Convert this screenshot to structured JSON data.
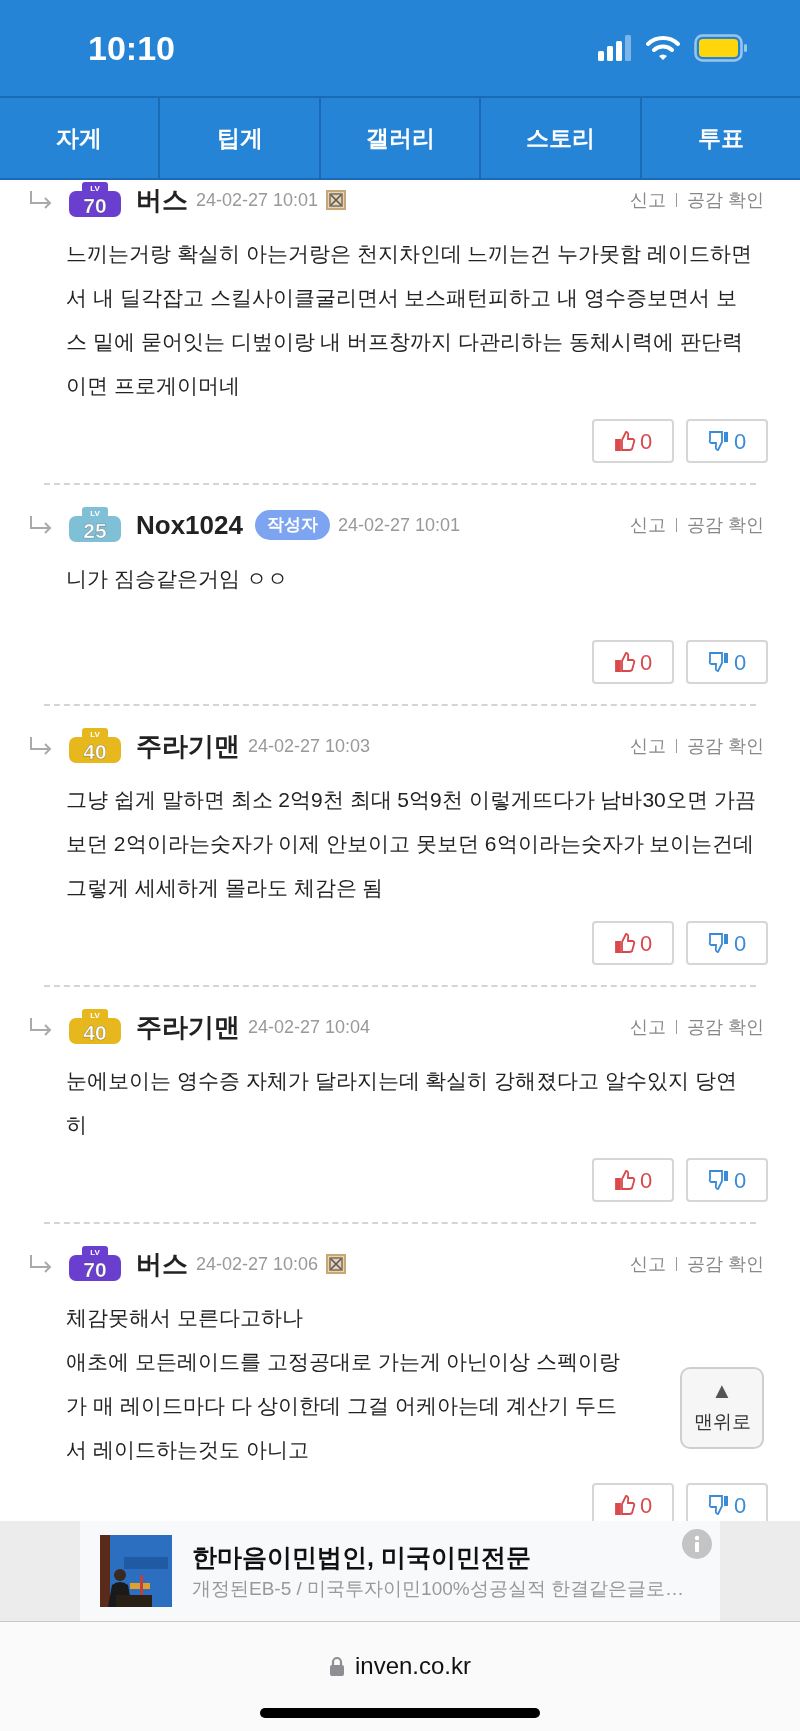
{
  "status_bar": {
    "time": "10:10"
  },
  "tabs": [
    {
      "label": "자게"
    },
    {
      "label": "팁게"
    },
    {
      "label": "갤러리"
    },
    {
      "label": "스토리"
    },
    {
      "label": "투표"
    }
  ],
  "comments": [
    {
      "badge_lv": "LV",
      "badge_level": "70",
      "color": "#6a3fd0",
      "author": "버스",
      "date": "24-02-27 10:01",
      "mark_icon": true,
      "report": "신고",
      "likes_check": "공감 확인",
      "body": "느끼는거랑 확실히 아는거랑은 천지차인데 느끼는건 누가못함 레이드하면서 내 딜각잡고 스킬사이클굴리면서 보스패턴피하고 내 영수증보면서 보스 밑에 묻어잇는 디벞이랑 내 버프창까지 다관리하는 동체시력에 판단력이면 프로게이머네",
      "up": "0",
      "down": "0"
    },
    {
      "badge_lv": "LV",
      "badge_level": "25",
      "color": "#7fc0d6",
      "author": "Nox1024",
      "author_tag": "작성자",
      "date": "24-02-27 10:01",
      "mark_icon": false,
      "report": "신고",
      "likes_check": "공감 확인",
      "body": "니가 짐승같은거임 ㅇㅇ",
      "up": "0",
      "down": "0"
    },
    {
      "badge_lv": "LV",
      "badge_level": "40",
      "color": "#e6b81e",
      "author": "주라기맨",
      "date": "24-02-27 10:03",
      "mark_icon": false,
      "report": "신고",
      "likes_check": "공감 확인",
      "body": "그냥 쉽게 말하면 최소 2억9천 최대 5억9천 이렇게뜨다가 남바30오면 가끔보던 2억이라는숫자가 이제 안보이고 못보던 6억이라는숫자가 보이는건데 그렇게 세세하게 몰라도 체감은 됨",
      "up": "0",
      "down": "0"
    },
    {
      "badge_lv": "LV",
      "badge_level": "40",
      "color": "#e6b81e",
      "author": "주라기맨",
      "date": "24-02-27 10:04",
      "mark_icon": false,
      "report": "신고",
      "likes_check": "공감 확인",
      "body": "눈에보이는 영수증 자체가 달라지는데 확실히 강해졌다고 알수있지 당연히",
      "up": "0",
      "down": "0"
    },
    {
      "badge_lv": "LV",
      "badge_level": "70",
      "color": "#6a3fd0",
      "author": "버스",
      "date": "24-02-27 10:06",
      "mark_icon": true,
      "report": "신고",
      "likes_check": "공감 확인",
      "body": "체감못해서 모른다고하나\n애초에 모든레이드를 고정공대로 가는게 아닌이상 스펙이랑\n가 매 레이드마다 다 상이한데 그걸 어케아는데 계산기 두드\n서 레이드하는것도 아니고",
      "up": "0",
      "down": "0"
    }
  ],
  "top_button": {
    "arrow": "▲",
    "label": "맨위로"
  },
  "ad": {
    "kind": "picture",
    "title": "한마음이민법인, 미국이민전문",
    "subtitle": "개정된EB-5 / 미국투자이민100%성공실적 한결같은글로…"
  },
  "address_bar": {
    "url": "inven.co.kr"
  }
}
